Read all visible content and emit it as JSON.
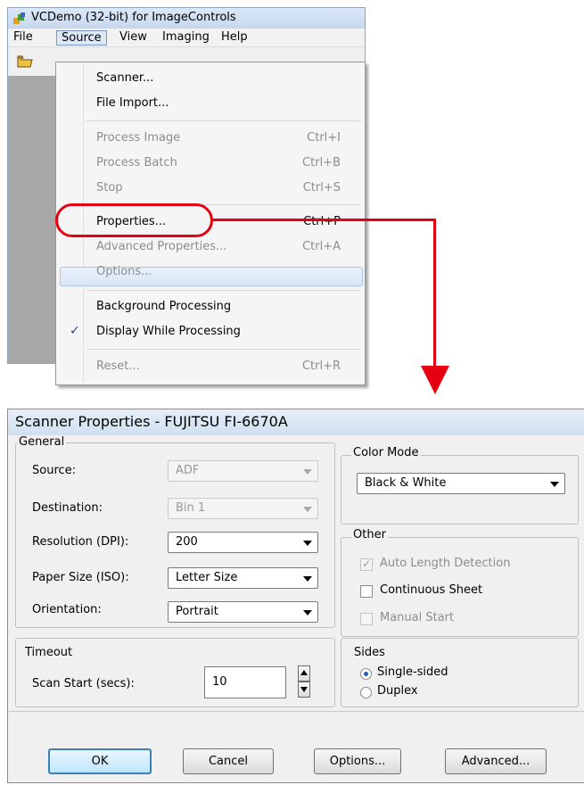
{
  "app": {
    "title": "VCDemo (32-bit) for ImageControls",
    "menu": [
      "File",
      "Source",
      "View",
      "Imaging",
      "Help"
    ]
  },
  "source_menu": {
    "items": [
      {
        "label": "Scanner...",
        "shortcut": ""
      },
      {
        "label": "File Import...",
        "shortcut": ""
      },
      {
        "label": "Process Image",
        "shortcut": "Ctrl+I"
      },
      {
        "label": "Process Batch",
        "shortcut": "Ctrl+B"
      },
      {
        "label": "Stop",
        "shortcut": "Ctrl+S"
      },
      {
        "label": "Properties...",
        "shortcut": "Ctrl+P"
      },
      {
        "label": "Advanced Properties...",
        "shortcut": "Ctrl+A"
      },
      {
        "label": "Options...",
        "shortcut": ""
      },
      {
        "label": "Background Processing",
        "shortcut": ""
      },
      {
        "label": "Display While Processing",
        "shortcut": "",
        "checked": true
      },
      {
        "label": "Reset...",
        "shortcut": "Ctrl+R"
      }
    ]
  },
  "dialog": {
    "title": "Scanner Properties - FUJITSU FI-6670A",
    "general": {
      "legend": "General",
      "source_label": "Source:",
      "source_value": "ADF",
      "destination_label": "Destination:",
      "destination_value": "Bin 1",
      "resolution_label": "Resolution (DPI):",
      "resolution_value": "200",
      "paper_label": "Paper Size (ISO):",
      "paper_value": "Letter Size",
      "orientation_label": "Orientation:",
      "orientation_value": "Portrait"
    },
    "color_mode": {
      "legend": "Color Mode",
      "value": "Black & White"
    },
    "other": {
      "legend": "Other",
      "auto_length": "Auto Length Detection",
      "continuous": "Continuous Sheet",
      "manual_start": "Manual Start"
    },
    "timeout": {
      "legend": "Timeout",
      "label": "Scan Start (secs):",
      "value": "10"
    },
    "sides": {
      "legend": "Sides",
      "single": "Single-sided",
      "duplex": "Duplex"
    },
    "buttons": {
      "ok": "OK",
      "cancel": "Cancel",
      "options": "Options...",
      "advanced": "Advanced..."
    }
  },
  "colors": {
    "callout": "#e60012",
    "highlight": "#d9e6f6"
  }
}
